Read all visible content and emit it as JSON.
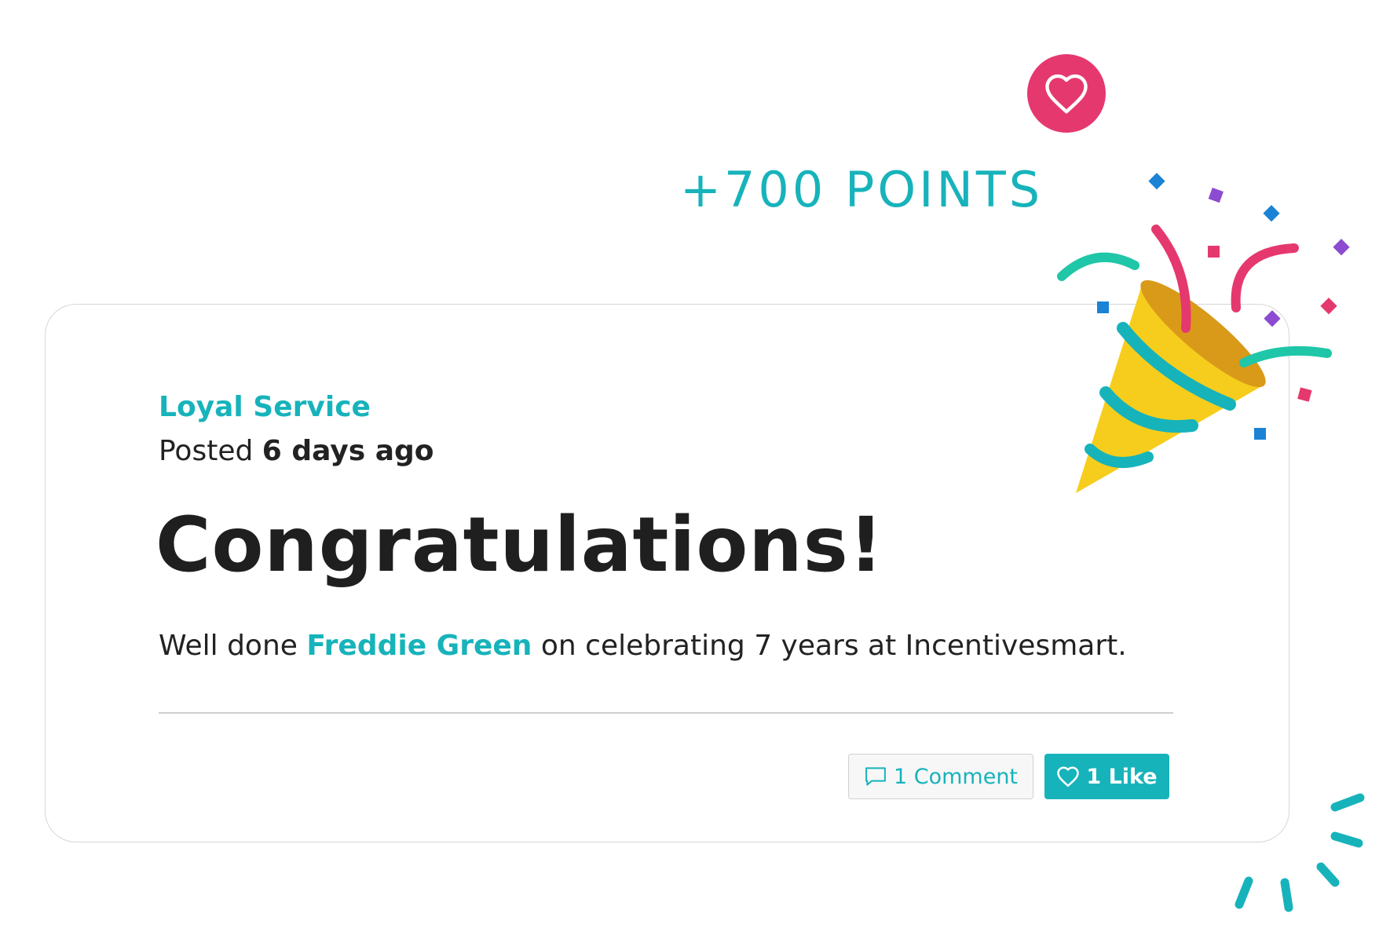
{
  "points": {
    "label": "+700 POINTS"
  },
  "post": {
    "category": "Loyal Service",
    "posted_prefix": "Posted ",
    "posted_time": "6 days ago",
    "headline": "Congratulations!",
    "message_prefix": "Well done ",
    "recipient": "Freddie Green",
    "message_suffix": " on celebrating 7 years at Incentivesmart."
  },
  "actions": {
    "comment_label": "1 Comment",
    "like_label": "1 Like"
  },
  "icons": {
    "badge": "heart-icon",
    "comment": "comment-icon",
    "like": "heart-outline-icon",
    "decoration": "party-popper-icon"
  },
  "colors": {
    "accent": "#17b3bb",
    "badge": "#e5386e",
    "text": "#222222"
  }
}
